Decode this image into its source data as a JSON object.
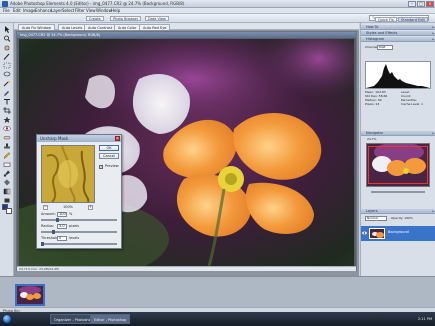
{
  "window": {
    "title": "Adobe Photoshop Elements 4.0 (Editor) - img_0477.CR2 @ 24.7% (Background, RGB/8)"
  },
  "menu": [
    "File",
    "Edit",
    "Image",
    "Enhance",
    "Layer",
    "Select",
    "Filter",
    "View",
    "Window",
    "Help"
  ],
  "options_bar": {
    "create_label": "Create",
    "photo_browser_label": "Photo Browser",
    "date_view_label": "Date View",
    "search_placeholder": "Type a question for help",
    "quick_fix_label": "Quick Fix",
    "standard_edit_label": "Standard Edit"
  },
  "doc_tabs": [
    "Auto Fix Window",
    "Auto Levels",
    "Auto Contrast",
    "Auto Color",
    "Auto Red Eye"
  ],
  "document": {
    "title": "img_0477.CR2 @ 24.7% (Background, RGB/8)",
    "status": "24.71%  Doc: 24.9M/24.9M"
  },
  "dialog": {
    "title": "Unsharp Mask",
    "ok": "OK",
    "cancel": "Cancel",
    "help": "Help",
    "preview_label": "Preview",
    "zoom_value": "100%",
    "amount_label": "Amount:",
    "amount_value": "100",
    "amount_unit": "%",
    "radius_label": "Radius:",
    "radius_value": "3.0",
    "radius_unit": "pixels",
    "threshold_label": "Threshold:",
    "threshold_value": "0",
    "threshold_unit": "levels",
    "amount_level": 0.2,
    "radius_level": 0.15,
    "threshold_level": 0.0
  },
  "panels": {
    "how_to": "How To",
    "styles": "Styles and Effects",
    "histogram": "Histogram",
    "channel_label": "Channel:",
    "channel_value": "RGB",
    "stats_left": [
      "Mean: 104.83",
      "Std Dev: 58.66",
      "Median: 94",
      "Pixels: 24"
    ],
    "stats_right": [
      "Level:",
      "Count:",
      "Percentile:",
      "Cache Level: 1"
    ],
    "navigator": "Navigator",
    "zoom_value": "24.7%",
    "layers": "Layers",
    "blend_mode": "Normal",
    "opacity": "Opacity: 100%",
    "layer_name": "Background"
  },
  "bin": {
    "label": "Photo Bin"
  },
  "taskbar": {
    "buttons": [
      "Organizer - Photoshop",
      "Editor - Photoshop"
    ],
    "clock": "2:11 PM"
  },
  "colors": {
    "accent": "#3a74c9",
    "flower": "#f39a3c",
    "flower_center": "#e8d43a"
  }
}
